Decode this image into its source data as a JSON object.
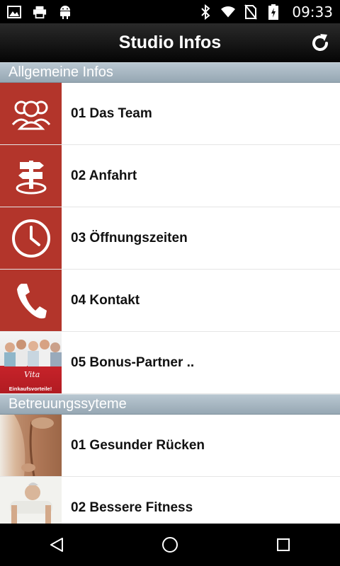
{
  "status_bar": {
    "time": "09:33",
    "left_icons": [
      "image-icon",
      "print-icon",
      "android-icon"
    ],
    "right_icons": [
      "bluetooth-icon",
      "wifi-icon",
      "no-sim-icon",
      "battery-icon"
    ]
  },
  "action_bar": {
    "title": "Studio Infos",
    "refresh_icon": "refresh-icon"
  },
  "sections": [
    {
      "title": "Allgemeine Infos",
      "items": [
        {
          "label": "01 Das Team",
          "icon": "team-icon"
        },
        {
          "label": "02 Anfahrt",
          "icon": "signpost-icon"
        },
        {
          "label": "03 Öffnungszeiten",
          "icon": "clock-icon"
        },
        {
          "label": "04 Kontakt",
          "icon": "phone-icon"
        },
        {
          "label": "05 Bonus-Partner ..",
          "icon": "bonus-partner-photo"
        }
      ]
    },
    {
      "title": "Betreuungssyteme",
      "items": [
        {
          "label": "01 Gesunder Rücken",
          "icon": "back-photo"
        },
        {
          "label": "02 Bessere Fitness",
          "icon": "fitness-photo"
        }
      ]
    }
  ],
  "bonus_photo_text": {
    "brand": "Vita",
    "caption": "Einkaufsvorteile!"
  },
  "colors": {
    "accent_red": "#b3352b",
    "section_bg": "#a4b4bf"
  },
  "nav_bar": {
    "icons": [
      "back-icon",
      "home-icon",
      "recents-icon"
    ]
  }
}
